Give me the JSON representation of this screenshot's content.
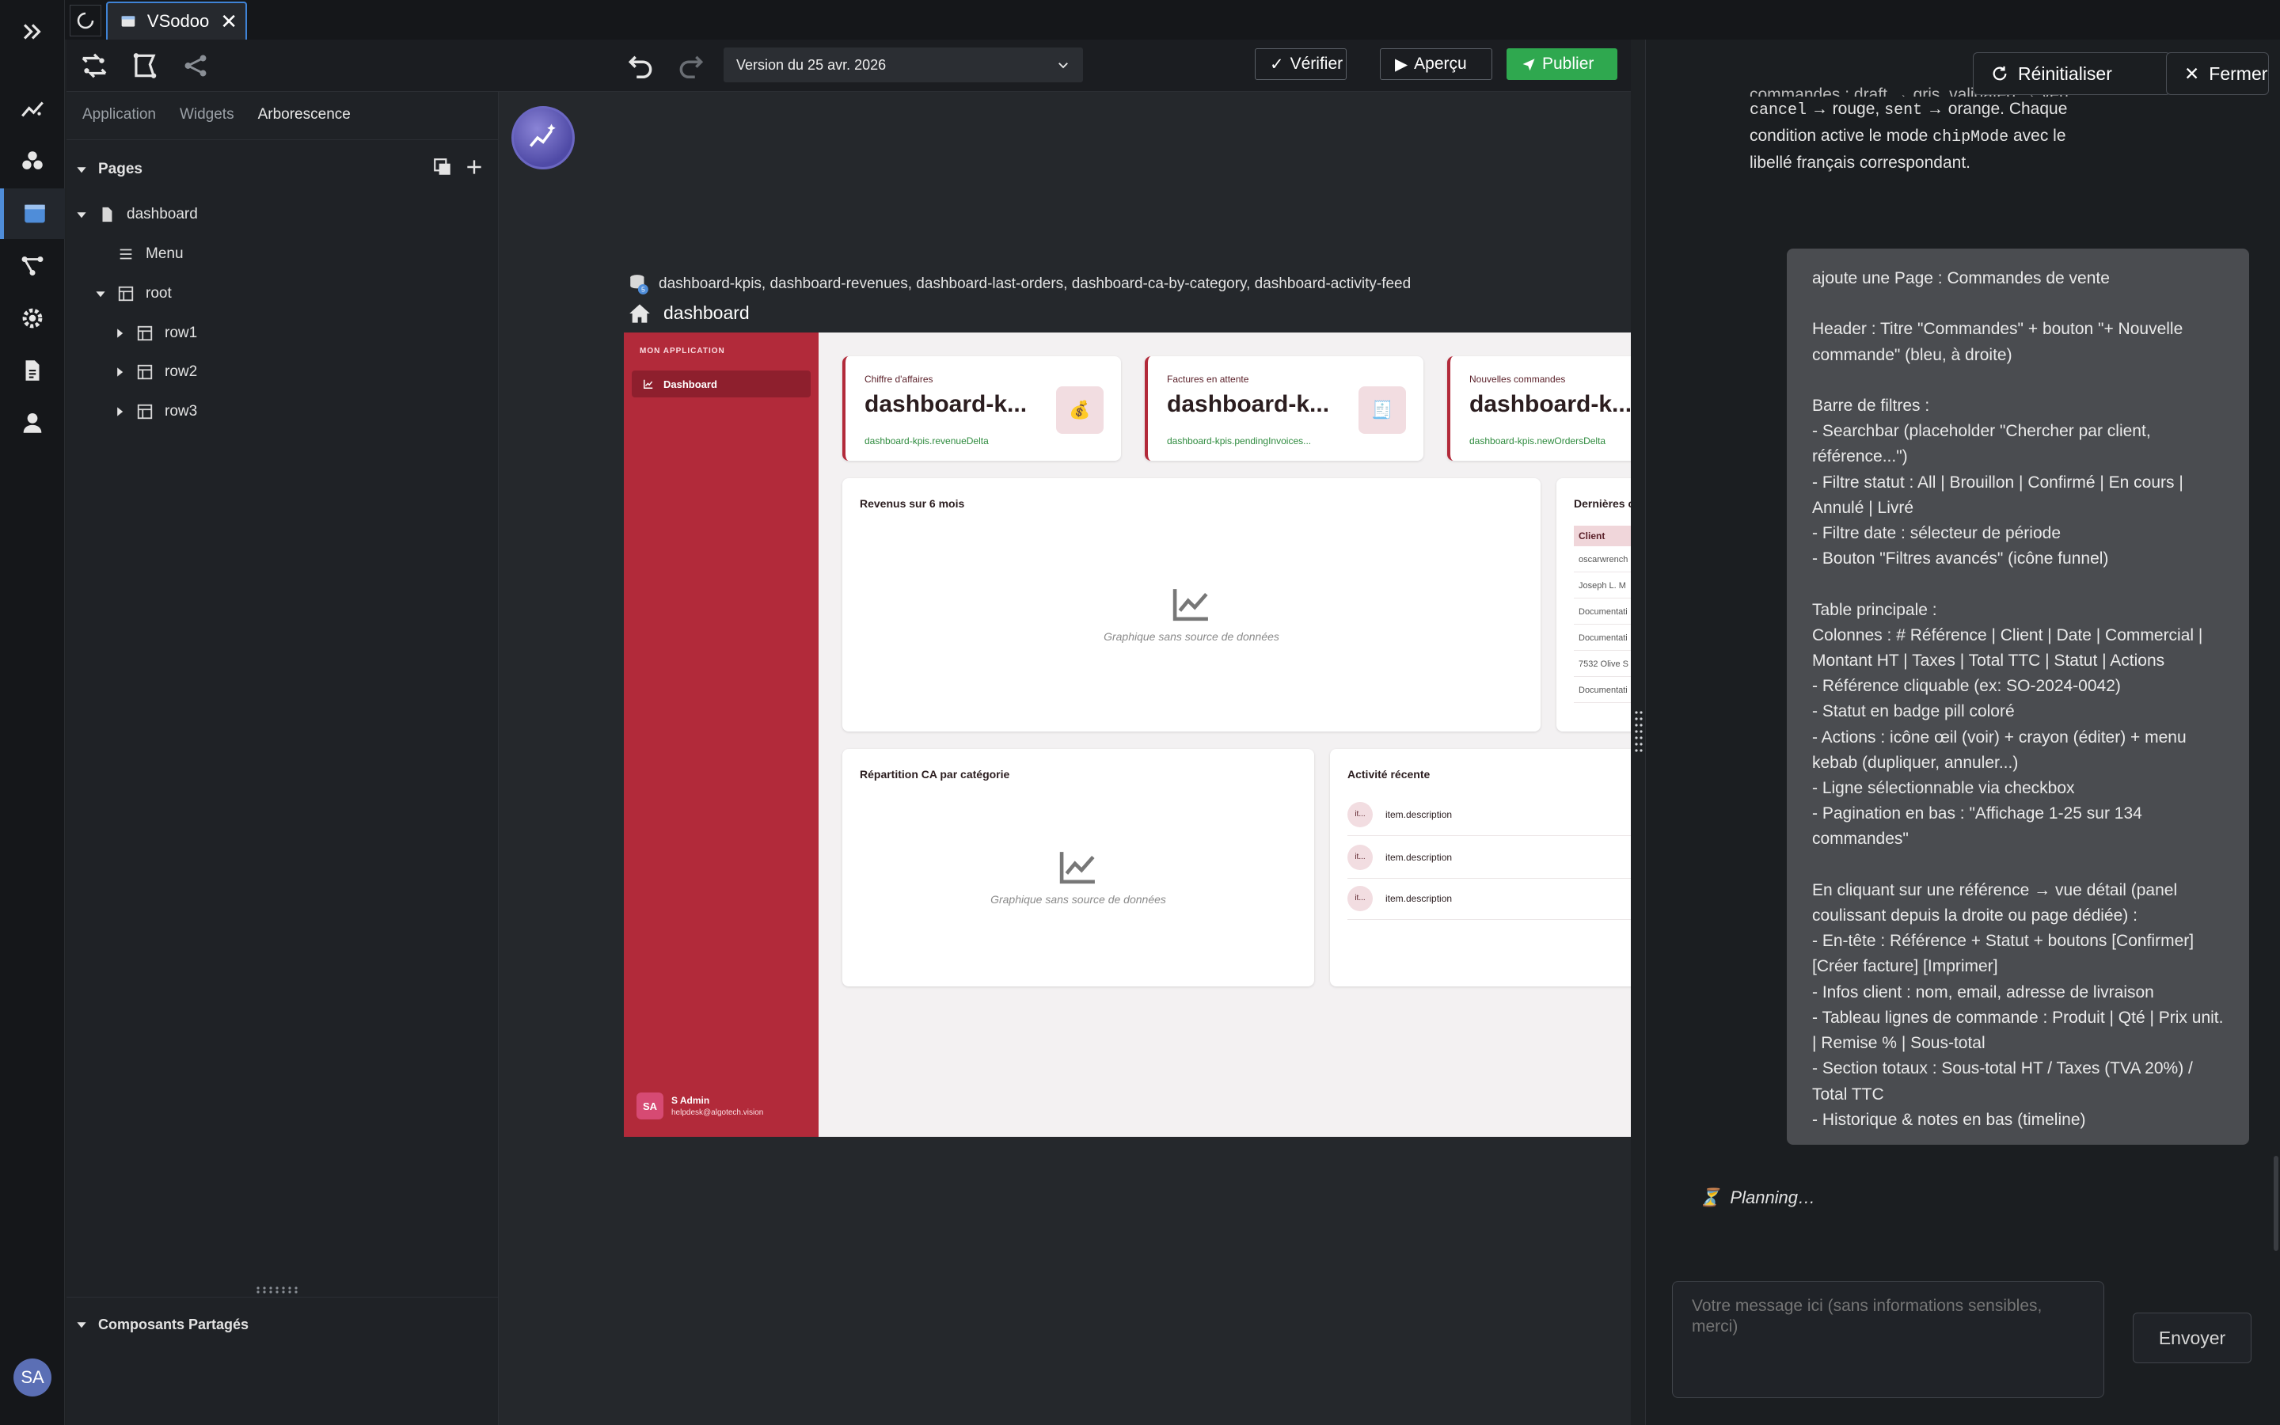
{
  "tabbar": {
    "tab_title": "VSodoo"
  },
  "toolbar": {
    "version": "Version du 25 avr. 2026",
    "verify": "Vérifier",
    "preview": "Aperçu",
    "publish": "Publier"
  },
  "left_panel": {
    "tabs": [
      "Application",
      "Widgets",
      "Arborescence"
    ],
    "active_tab": "Arborescence",
    "pages_header": "Pages",
    "tree": {
      "dashboard": "dashboard",
      "menu": "Menu",
      "root": "root",
      "row1": "row1",
      "row2": "row2",
      "row3": "row3"
    },
    "shared_header": "Composants Partagés"
  },
  "canvas": {
    "datasources": "dashboard-kpis, dashboard-revenues, dashboard-last-orders, dashboard-ca-by-category, dashboard-activity-feed",
    "datasource_count": "5",
    "page_name": "dashboard"
  },
  "app_preview": {
    "app_name": "MON APPLICATION",
    "nav_item": "Dashboard",
    "user_initials": "SA",
    "user_name": "S Admin",
    "user_email": "helpdesk@algotech.vision",
    "kpis": [
      {
        "label": "Chiffre d'affaires",
        "value": "dashboard-k...",
        "delta": "dashboard-kpis.revenueDelta",
        "icon": "💰"
      },
      {
        "label": "Factures en attente",
        "value": "dashboard-k...",
        "delta": "dashboard-kpis.pendingInvoices...",
        "icon": "🧾"
      },
      {
        "label": "Nouvelles commandes",
        "value": "dashboard-k...",
        "delta": "dashboard-kpis.newOrdersDelta",
        "icon": ""
      }
    ],
    "revenue_card": {
      "title": "Revenus sur 6 mois",
      "empty": "Graphique sans source de données"
    },
    "orders_card": {
      "title": "Dernières c",
      "column": "Client",
      "rows": [
        "oscarwrench",
        "Joseph L. M",
        "Documentati",
        "Documentati",
        "7532 Olive S",
        "Documentati"
      ]
    },
    "category_card": {
      "title": "Répartition CA par catégorie",
      "empty": "Graphique sans source de données"
    },
    "activity_card": {
      "title": "Activité récente",
      "items": [
        {
          "dot": "it...",
          "text": "item.description"
        },
        {
          "dot": "it...",
          "text": "item.description"
        },
        {
          "dot": "it...",
          "text": "item.description"
        }
      ]
    }
  },
  "chat": {
    "reset": "Réinitialiser",
    "close": "Fermer",
    "prev_line1": "commandes : draft → gris, validated → vert,",
    "prev_code1": "cancel",
    "prev_t1": " → rouge, ",
    "prev_code2": "sent",
    "prev_t2": " → orange. Chaque condition active le mode ",
    "prev_code3": "chipMode",
    "prev_t3": " avec le libellé français correspondant.",
    "user_message": "ajoute une Page : Commandes de vente\n\nHeader : Titre \"Commandes\" + bouton \"+ Nouvelle commande\" (bleu, à droite)\n\nBarre de filtres :\n- Searchbar (placeholder \"Chercher par client, référence...\")\n- Filtre statut : All | Brouillon | Confirmé | En cours | Annulé | Livré\n- Filtre date : sélecteur de période\n- Bouton \"Filtres avancés\" (icône funnel)\n\nTable principale :\nColonnes : # Référence | Client | Date | Commercial | Montant HT | Taxes | Total TTC | Statut | Actions\n- Référence cliquable (ex: SO-2024-0042)\n- Statut en badge pill coloré\n- Actions : icône œil (voir) + crayon (éditer) + menu kebab (dupliquer, annuler...)\n- Ligne sélectionnable via checkbox\n- Pagination en bas : \"Affichage 1-25 sur 134 commandes\"\n\nEn cliquant sur une référence → vue détail (panel coulissant depuis la droite ou page dédiée) :\n- En-tête : Référence + Statut + boutons [Confirmer] [Créer facture] [Imprimer]\n- Infos client : nom, email, adresse de livraison\n- Tableau lignes de commande : Produit | Qté | Prix unit. | Remise % | Sous-total\n- Section totaux : Sous-total HT / Taxes (TVA 20%) / Total TTC\n- Historique & notes en bas (timeline)",
    "planning": "Planning…",
    "input_placeholder": "Votre message ici (sans informations sensibles, merci)",
    "send": "Envoyer"
  },
  "rail": {
    "avatar": "SA"
  },
  "colors": {
    "accent": "#4f8dd9",
    "publish": "#2fa84f",
    "app_primary": "#b22a3a"
  }
}
